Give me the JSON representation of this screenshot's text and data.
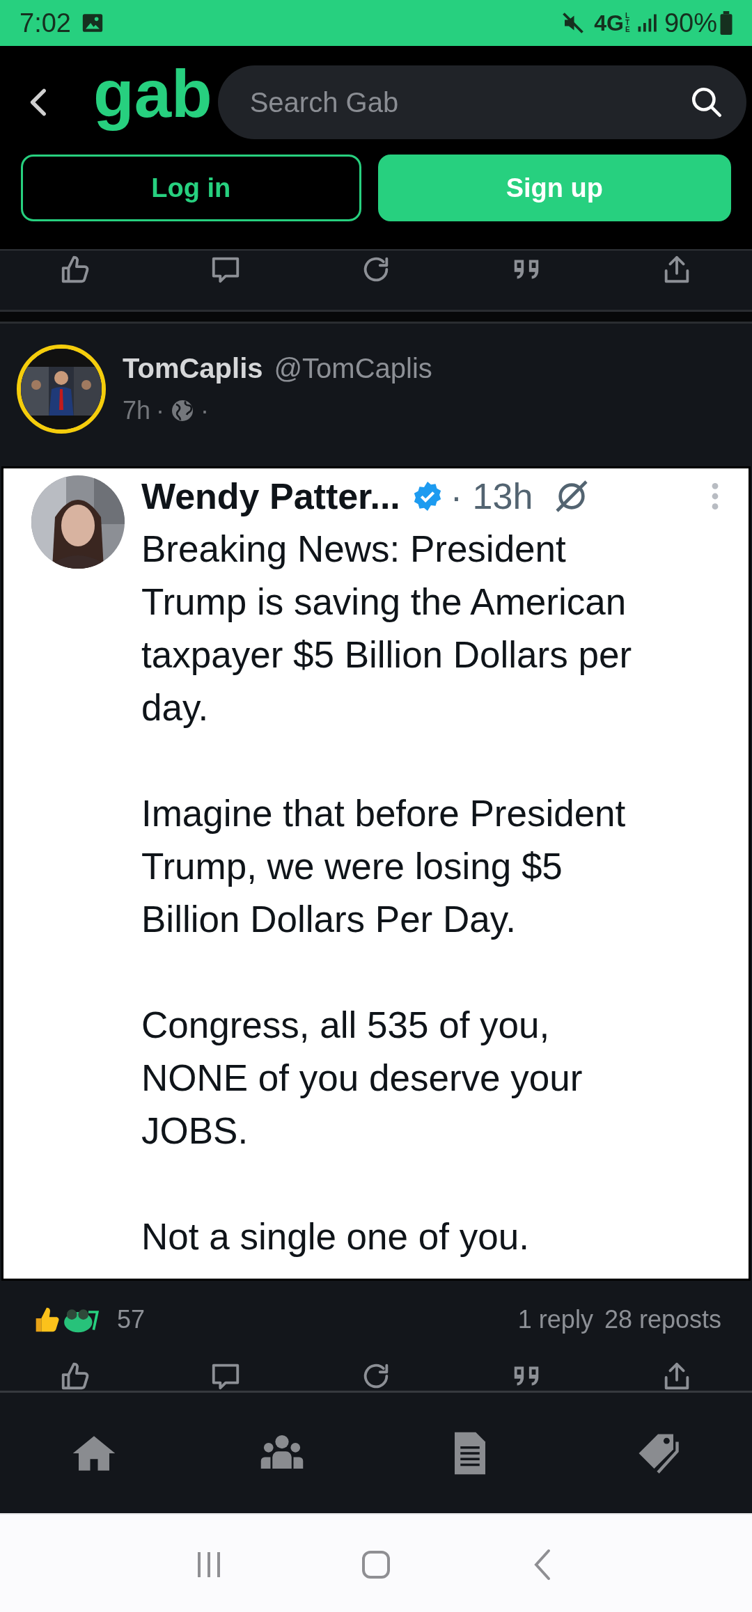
{
  "status_bar": {
    "time": "7:02",
    "network": "4G",
    "network_sub": "LTE",
    "battery": "90%"
  },
  "header": {
    "logo": "gab",
    "search": {
      "placeholder": "Search Gab"
    },
    "buttons": [
      {
        "label": "Log in",
        "kind": "outline"
      },
      {
        "label": "Sign up",
        "kind": "filled"
      }
    ]
  },
  "post": {
    "author": "TomCaplis",
    "handle": "@TomCaplis",
    "time": "7h",
    "dots": [
      "·",
      "·"
    ],
    "embedded_tweet": {
      "name": "Wendy Patter...",
      "verified": true,
      "time": "· 13h",
      "paragraphs": [
        "Breaking News: President\nTrump is saving the American\ntaxpayer $5 Billion Dollars per\nday.",
        "Imagine that before President\nTrump, we were losing $5\nBillion Dollars Per Day.",
        "Congress, all 535 of you,\nNONE of you deserve your\nJOBS.",
        "Not a single one of you."
      ]
    },
    "reaction_count": "57",
    "replies": "1 reply",
    "reposts": "28 reposts"
  }
}
